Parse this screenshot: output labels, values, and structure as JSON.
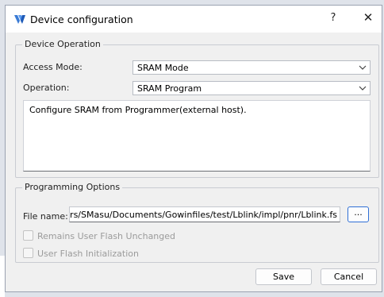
{
  "window": {
    "title": "Device configuration",
    "help_label": "?",
    "close_label": "✕"
  },
  "device_operation": {
    "group_title": "Device Operation",
    "access_mode_label": "Access Mode:",
    "access_mode_value": "SRAM Mode",
    "operation_label": "Operation:",
    "operation_value": "SRAM Program",
    "description": "Configure SRAM from Programmer(external host)."
  },
  "programming_options": {
    "group_title": "Programming Options",
    "file_name_label": "File name:",
    "file_name_value": "C:/Users/SMasu/Documents/Gowinfiles/test/Lblink/impl/pnr/Lblink.fs",
    "browse_label": "...",
    "checkbox_flash_unchanged_label": "Remains User Flash Unchanged",
    "checkbox_flash_init_label": "User Flash Initialization"
  },
  "buttons": {
    "save_label": "Save",
    "cancel_label": "Cancel"
  },
  "colors": {
    "accent": "#2f6fd6",
    "dialog_bg": "#f0f0f0",
    "disabled_text": "#9b9b9b"
  }
}
